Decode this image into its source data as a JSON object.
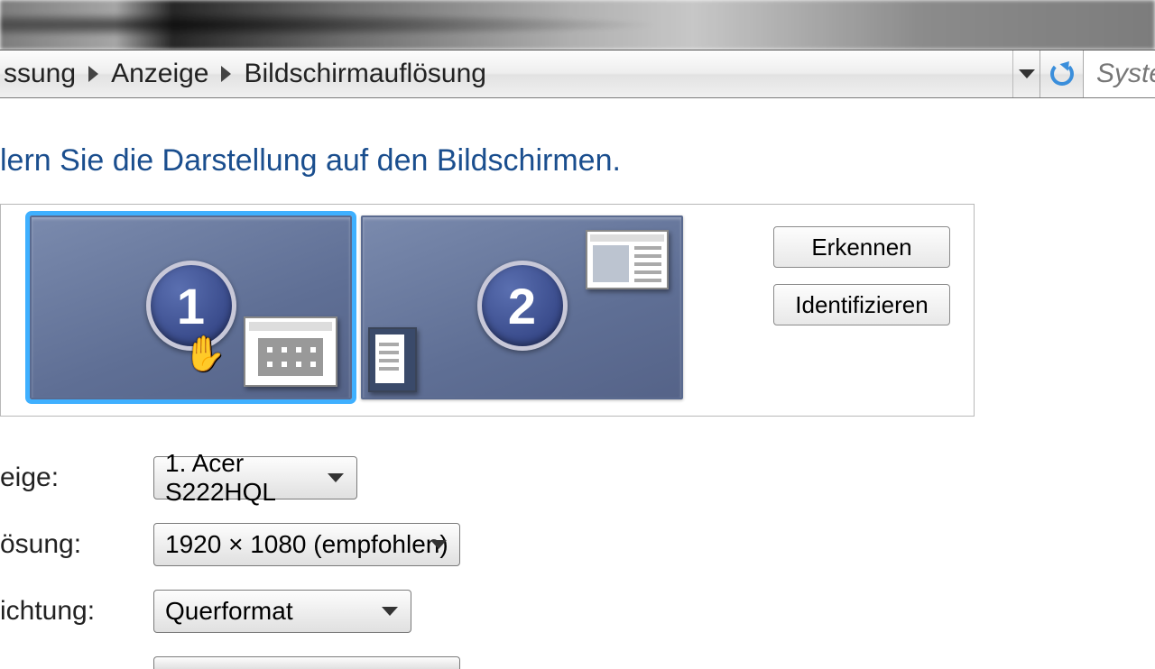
{
  "breadcrumb": {
    "seg0": "ssung",
    "seg1": "Anzeige",
    "seg2": "Bildschirmauflösung"
  },
  "search_placeholder": "Syster",
  "heading": "lern Sie die Darstellung auf den Bildschirmen.",
  "monitors": {
    "m1": "1",
    "m2": "2"
  },
  "buttons": {
    "detect": "Erkennen",
    "identify": "Identifizieren"
  },
  "labels": {
    "display": "eige:",
    "resolution": "ösung:",
    "orientation": "ichtung:"
  },
  "values": {
    "display": "1. Acer S222HQL",
    "resolution": "1920 × 1080 (empfohlen)",
    "orientation": "Querformat"
  }
}
